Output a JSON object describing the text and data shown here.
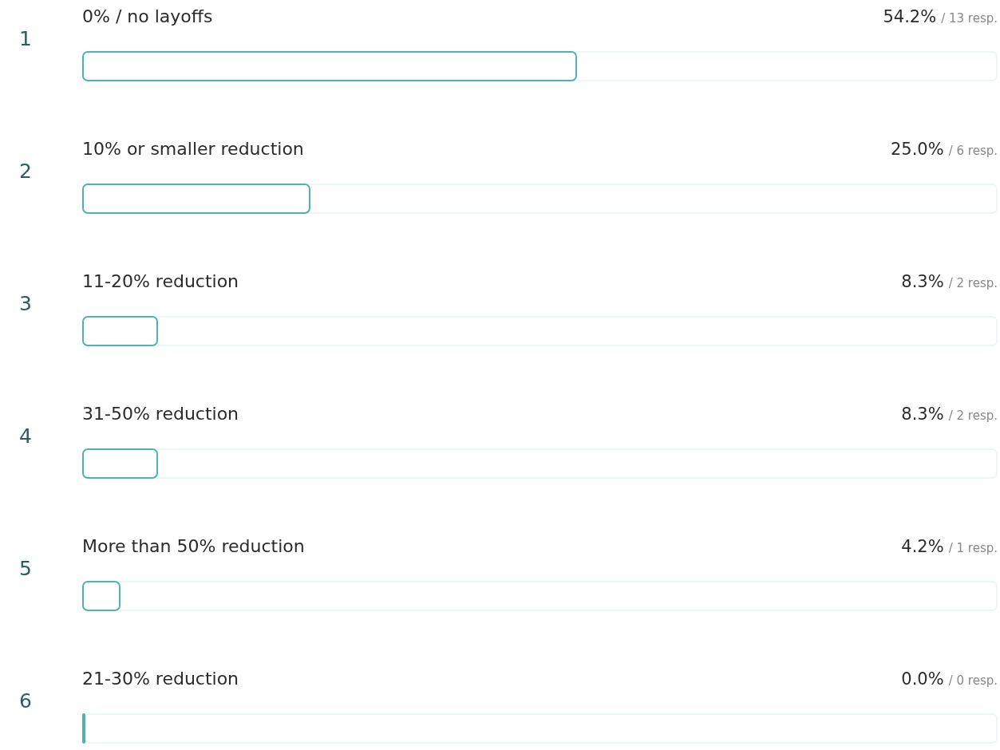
{
  "results": [
    {
      "rank": "1",
      "label": "0% / no layoffs",
      "percent": "54.2%",
      "responses": "/ 13 resp.",
      "level": 0.542
    },
    {
      "rank": "2",
      "label": "10% or smaller reduction",
      "percent": "25.0%",
      "responses": "/ 6 resp.",
      "level": 0.25
    },
    {
      "rank": "3",
      "label": "11-20% reduction",
      "percent": "8.3%",
      "responses": "/ 2 resp.",
      "level": 0.083
    },
    {
      "rank": "4",
      "label": "31-50% reduction",
      "percent": "8.3%",
      "responses": "/ 2 resp.",
      "level": 0.083
    },
    {
      "rank": "5",
      "label": "More than 50% reduction",
      "percent": "4.2%",
      "responses": "/ 1 resp.",
      "level": 0.042
    },
    {
      "rank": "6",
      "label": "21-30% reduction",
      "percent": "0.0%",
      "responses": "/ 0 resp.",
      "level": 0
    }
  ]
}
